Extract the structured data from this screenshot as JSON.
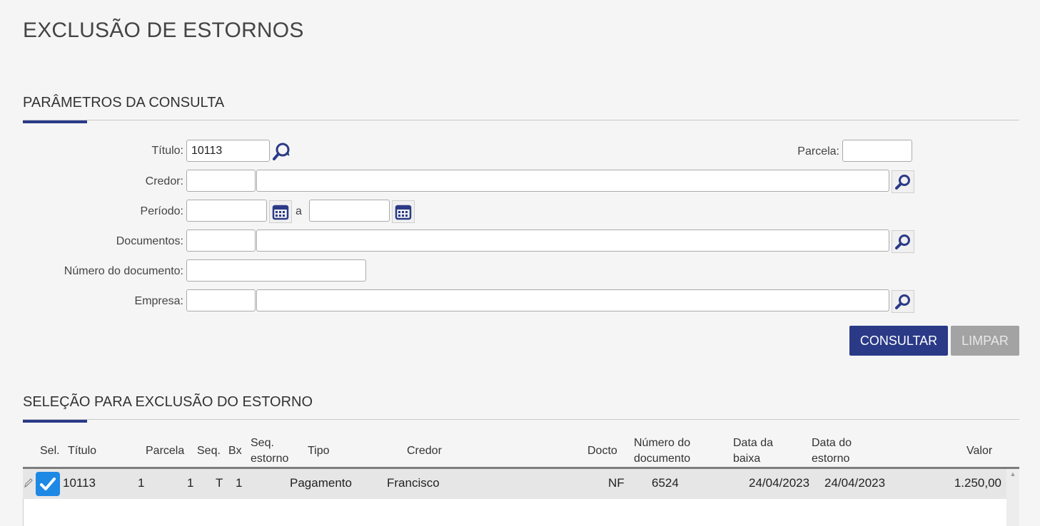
{
  "page": {
    "title": "EXCLUSÃO DE ESTORNOS"
  },
  "params": {
    "section_title": "PARÂMETROS DA CONSULTA",
    "titulo_label": "Título:",
    "titulo_value": "10113",
    "parcela_label": "Parcela:",
    "parcela_value": "",
    "credor_label": "Credor:",
    "periodo_label": "Período:",
    "periodo_sep": "a",
    "documentos_label": "Documentos:",
    "numero_doc_label": "Número do documento:",
    "empresa_label": "Empresa:",
    "consultar_label": "CONSULTAR",
    "limpar_label": "LIMPAR"
  },
  "selection": {
    "section_title": "SELEÇÃO PARA EXCLUSÃO DO ESTORNO",
    "columns": {
      "sel": "Sel.",
      "titulo": "Título",
      "parcela": "Parcela",
      "seq": "Seq.",
      "bx": "Bx",
      "seq_estorno_1": "Seq.",
      "seq_estorno_2": "estorno",
      "tipo": "Tipo",
      "credor": "Credor",
      "docto": "Docto",
      "num_doc_1": "Número do",
      "num_doc_2": "documento",
      "data_baixa_1": "Data da",
      "data_baixa_2": "baixa",
      "data_estorno_1": "Data do",
      "data_estorno_2": "estorno",
      "valor": "Valor"
    },
    "rows": [
      {
        "selected": true,
        "titulo": "10113",
        "parcela": "1",
        "seq": "1",
        "bx": "T",
        "seq_estorno": "1",
        "tipo": "Pagamento",
        "credor": "Francisco",
        "docto": "NF",
        "numero_documento": "6524",
        "data_baixa": "24/04/2023",
        "data_estorno": "24/04/2023",
        "valor": "1.250,00"
      }
    ]
  },
  "colors": {
    "accent": "#2b3a87",
    "checkbox": "#1e88e5",
    "disabled": "#a3a3a3"
  }
}
